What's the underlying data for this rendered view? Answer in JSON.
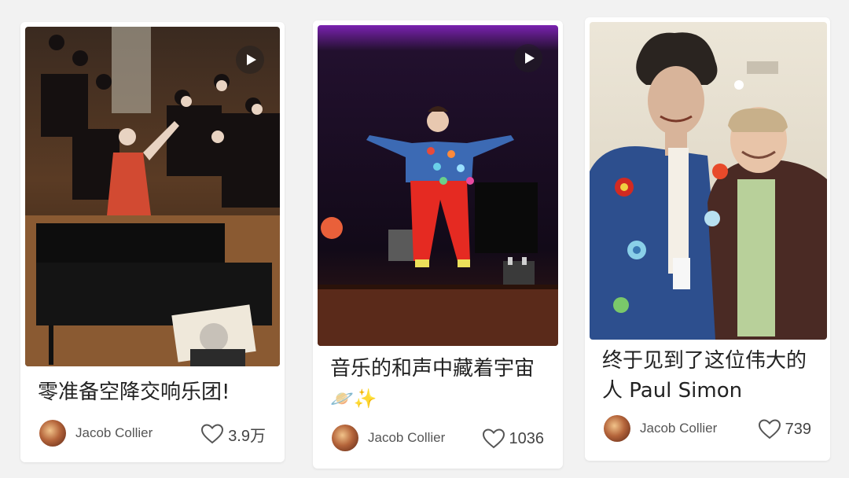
{
  "colors": {
    "card_background": "#ffffff",
    "page_background": "#f2f2f2",
    "title_text": "#222222",
    "meta_text": "#555555"
  },
  "feed": {
    "cards": [
      {
        "title": "零准备空降交响乐团!",
        "author": "Jacob Collier",
        "likes": "3.9万",
        "is_video": true,
        "cover_icon": "orchestra-photo"
      },
      {
        "title": "音乐的和声中藏着宇宙",
        "title_emoji": "🪐✨",
        "author": "Jacob Collier",
        "likes": "1036",
        "is_video": true,
        "cover_icon": "stage-performance-photo"
      },
      {
        "title": "终于见到了这位伟大的人 Paul Simon",
        "author": "Jacob Collier",
        "likes": "739",
        "is_video": false,
        "cover_icon": "portrait-photo"
      }
    ]
  }
}
